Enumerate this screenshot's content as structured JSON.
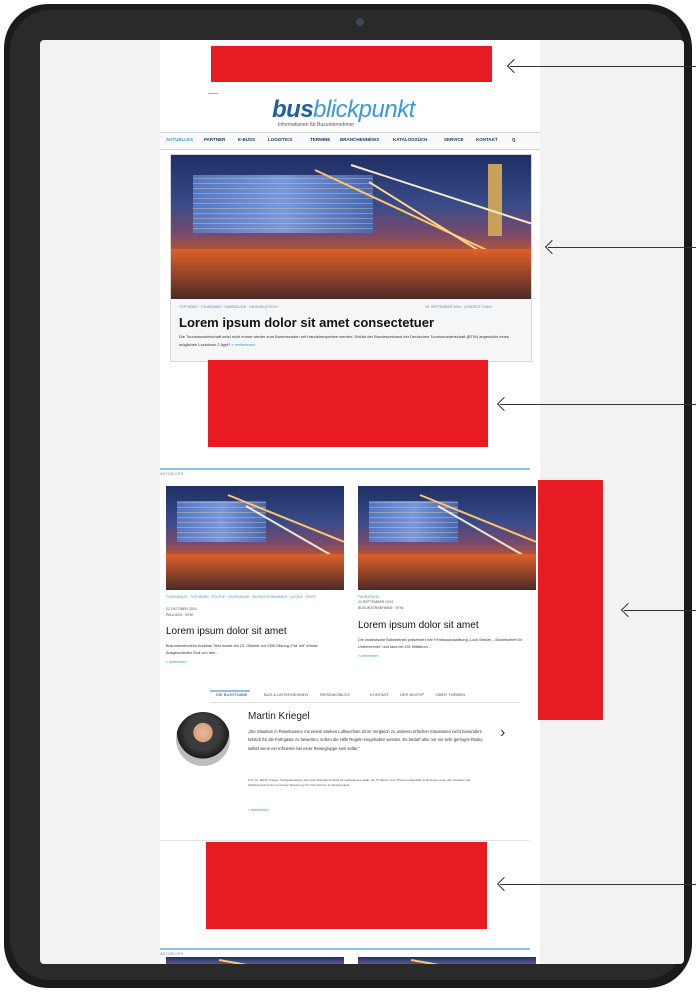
{
  "site": {
    "logo_bold": "bus",
    "logo_light": "blickpunkt",
    "tagline": "Informationen für Busunternehmer"
  },
  "nav": {
    "items": [
      "AKTUELLES",
      "PARTNER",
      "E-BUSS",
      "LOGISTICS",
      "TERMINE",
      "BRANCHENNEWS",
      "KATALOGSÜCH",
      "SERVICE",
      "KONTAKT",
      "Q"
    ]
  },
  "hero": {
    "categories": "TOP NEWS · TOURISMUS · FAHRZEUGE · FAHRZEUGTECH",
    "meta_right": "25. SEPTEMBER 2024 · LESEZEIT: 3 MIN",
    "title": "Lorem ipsum dolor sit amet consectetuer",
    "text": "Die Tourismuswirtschaft setzt nicht immer wieder zum Busreisenden mit Handelsexpertise werden. Erklärt der Bundesverband der Deutschen Tourismuswirtschaft (BTW) angesichts eines möglichen Lockdown 2 light?",
    "more": "» weiterlesen"
  },
  "section": {
    "label": "AKTUELLES"
  },
  "cards": [
    {
      "tags": "TOURISMUS · TOP NEWS · POLITIK · FAHRZEUGE · BUSUNTERNEHMEN · LEXIKA · GRIFF",
      "date": "22 OKTOBER 2024",
      "author": "PAULSEN · BTW",
      "title": "Lorem ipsum dolor sit amet",
      "text": "Busunternehmerin Andreas Tietz wurde am 23. Oktober zur VDB-Sitzung „Fair mit\" erfasst Ausgeschieden Stoll von den...",
      "more": "» weiterlesen"
    },
    {
      "tags": "FAHRZEUGE",
      "date": "21 SEPTEMBER 2024",
      "author": "BUSUNTERNEHMEN · BTW",
      "title": "Lorem ipsum dolor sit amet",
      "text": "Die ostdeutsche Bahnbetrieb präsentiert ihre Fernbusausstattung „Look Besser – Busreiseheft für Unternehmer\" und fand bei 201 Mitfahren...",
      "more": "» weiterlesen"
    }
  ],
  "tabs": [
    "DIE BUSSTIMME",
    "BUS & UNTERNEHMEN",
    "REISEMOBILES",
    "KONTAKT",
    "DER BUSTIP",
    "ÜBER THEMEN"
  ],
  "quote": {
    "name": "Martin Kriegel",
    "text": "„Die Situation in Reisebussen mit einem starken Luftwechsel ist im Vergleich zu anderen örtlichen Situationen nicht besonders kritisch für die Fahrgäste zu bewerten, sofern die Hilfe Regeln eingehalten werden. Es bedarf also nur ein sehr geringes Risiko, selbst wenn ein Infizierter bei einer Reisegruppe sein sollte.\"",
    "small": "Prof. Dr. Martin Kriegel, Fachgebietsleiter Hermann-Rietschel-Institut für Gebäudeenergetik, der TU Berlin, zum Thema Luftqualität im Reisebus unter den Aspekten der Infektionsprävention und deren Bewertung für Unternehmer im Reiseverkehr.",
    "more": "» weiterlesen",
    "prev": "‹",
    "next": "›"
  },
  "next_section": {
    "label": "AKTUELLES"
  },
  "colors": {
    "ad_red": "#e81b23",
    "brand_blue": "#1f5fa8",
    "accent_blue": "#3a9ad9"
  }
}
